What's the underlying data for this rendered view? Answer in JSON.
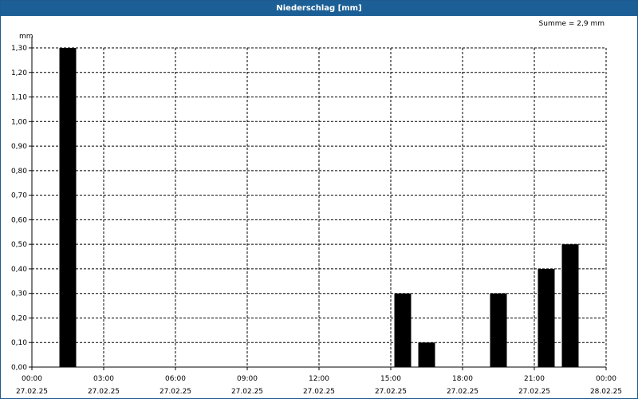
{
  "title": "Niederschlag [mm]",
  "summary": "Summe = 2,9 mm",
  "chart_data": {
    "type": "bar",
    "title": "Niederschlag [mm]",
    "ylabel": "mm",
    "ylim": [
      0,
      1.3
    ],
    "y_ticks": [
      "0,00",
      "0,10",
      "0,20",
      "0,30",
      "0,40",
      "0,50",
      "0,60",
      "0,70",
      "0,80",
      "0,90",
      "1,00",
      "1,10",
      "1,20",
      "1,30"
    ],
    "x_range_hours": [
      0,
      24
    ],
    "x_ticks": [
      {
        "time": "00:00",
        "date": "27.02.25"
      },
      {
        "time": "03:00",
        "date": "27.02.25"
      },
      {
        "time": "06:00",
        "date": "27.02.25"
      },
      {
        "time": "09:00",
        "date": "27.02.25"
      },
      {
        "time": "12:00",
        "date": "27.02.25"
      },
      {
        "time": "15:00",
        "date": "27.02.25"
      },
      {
        "time": "18:00",
        "date": "27.02.25"
      },
      {
        "time": "21:00",
        "date": "27.02.25"
      },
      {
        "time": "00:00",
        "date": "28.02.25"
      }
    ],
    "bar_color": "#000000",
    "grid": true,
    "bars": [
      {
        "hour": "01:00",
        "value": 1.3
      },
      {
        "hour": "15:00",
        "value": 0.3
      },
      {
        "hour": "16:00",
        "value": 0.1
      },
      {
        "hour": "19:00",
        "value": 0.3
      },
      {
        "hour": "21:00",
        "value": 0.4
      },
      {
        "hour": "22:00",
        "value": 0.5
      }
    ],
    "total": "2,9 mm"
  }
}
